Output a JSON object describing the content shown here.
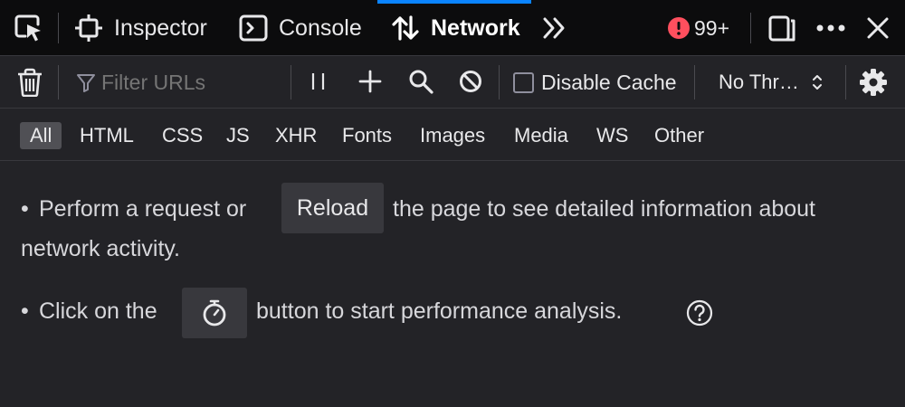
{
  "tabs": {
    "inspector": "Inspector",
    "console": "Console",
    "network": "Network",
    "error_count": "99+"
  },
  "toolbar": {
    "filter_placeholder": "Filter URLs",
    "disable_cache": "Disable Cache",
    "throttle": "No Thr…"
  },
  "filters": [
    "All",
    "HTML",
    "CSS",
    "JS",
    "XHR",
    "Fonts",
    "Images",
    "Media",
    "WS",
    "Other"
  ],
  "empty": {
    "line1_pre": "Perform a request or",
    "reload": "Reload",
    "line1_post": "the page to see detailed information about",
    "line1_cont": "network activity.",
    "line2_pre": "Click on the",
    "line2_post": "button to start performance analysis."
  },
  "colors": {
    "accent": "#0a84ff",
    "error": "#ff4f5e",
    "panel": "#232327",
    "tabbar": "#0c0c0d"
  }
}
